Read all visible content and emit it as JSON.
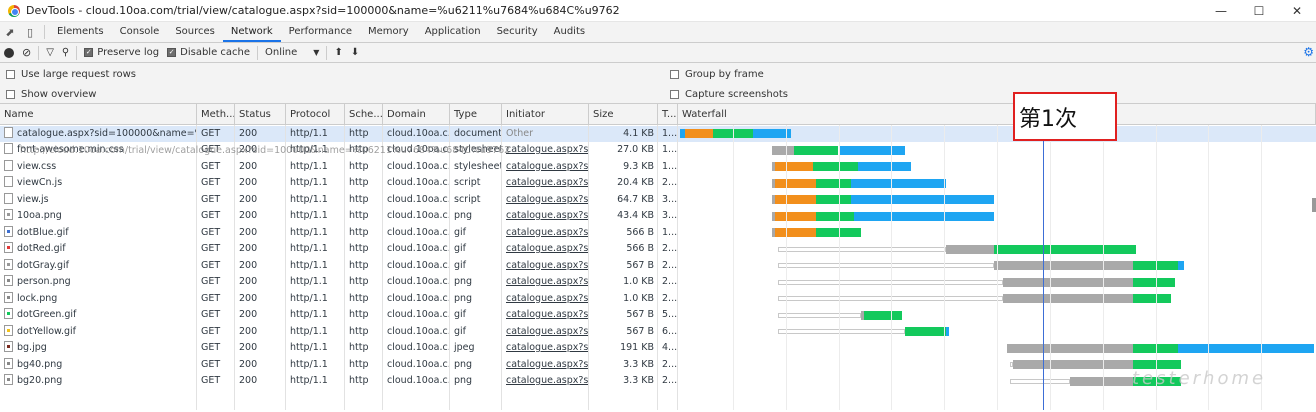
{
  "window": {
    "title": "DevTools - cloud.10oa.com/trial/view/catalogue.aspx?sid=100000&name=%u6211%u7684%u684C%u9762"
  },
  "tabs": [
    "Elements",
    "Console",
    "Sources",
    "Network",
    "Performance",
    "Memory",
    "Application",
    "Security",
    "Audits"
  ],
  "active_tab": "Network",
  "toolbar": {
    "preserve_log": "Preserve log",
    "disable_cache": "Disable cache",
    "throttle": "Online"
  },
  "options": {
    "large_rows": "Use large request rows",
    "show_overview": "Show overview",
    "group_by_frame": "Group by frame",
    "capture_screenshots": "Capture screenshots"
  },
  "columns": [
    "Name",
    "Meth...",
    "Status",
    "Protocol",
    "Sche...",
    "Domain",
    "Type",
    "Initiator",
    "Size",
    "T...",
    "Waterfall"
  ],
  "hover_url": "http://cloud.10oa.com/trial/view/catalogue.aspx?sid=100000&name=%u6211%u7684%u684C%u9762",
  "annotation": "第1次",
  "watermark": "testerhome",
  "colors": {
    "queue": "#a9a9a9",
    "wait": "#f28f1c",
    "ttfb": "#13c95c",
    "download": "#1ea5f2",
    "marker": "#3c6ed6"
  },
  "rows": [
    {
      "name": "catalogue.aspx?sid=100000&name=%u...",
      "method": "GET",
      "status": "200",
      "protocol": "http/1.1",
      "scheme": "http",
      "domain": "cloud.10oa.c...",
      "type": "document",
      "initiator": "Other",
      "size": "4.1 KB",
      "time": "1...",
      "icon": "doc",
      "wf": [
        [
          0.0,
          0.8,
          "#1ea5f2"
        ],
        [
          0.8,
          5.2,
          "#f28f1c"
        ],
        [
          5.2,
          11.5,
          "#13c95c"
        ],
        [
          11.5,
          17.5,
          "#1ea5f2"
        ]
      ]
    },
    {
      "name": "font-awesome.min.css",
      "method": "GET",
      "status": "200",
      "protocol": "http/1.1",
      "scheme": "http",
      "domain": "cloud.10oa.c...",
      "type": "stylesheet",
      "initiator": "catalogue.aspx?si...",
      "size": "27.0 KB",
      "time": "1...",
      "icon": "doc",
      "wf": [
        [
          14.5,
          18.0,
          "#a9a9a9"
        ],
        [
          18.0,
          25.0,
          "#13c95c"
        ],
        [
          25.0,
          35.5,
          "#1ea5f2"
        ]
      ]
    },
    {
      "name": "view.css",
      "method": "GET",
      "status": "200",
      "protocol": "http/1.1",
      "scheme": "http",
      "domain": "cloud.10oa.c...",
      "type": "stylesheet",
      "initiator": "catalogue.aspx?si...",
      "size": "9.3 KB",
      "time": "1...",
      "icon": "doc",
      "wf": [
        [
          14.5,
          15.0,
          "#a9a9a9"
        ],
        [
          15.0,
          21.0,
          "#f28f1c"
        ],
        [
          21.0,
          28.0,
          "#13c95c"
        ],
        [
          28.0,
          36.5,
          "#1ea5f2"
        ]
      ]
    },
    {
      "name": "viewCn.js",
      "method": "GET",
      "status": "200",
      "protocol": "http/1.1",
      "scheme": "http",
      "domain": "cloud.10oa.c...",
      "type": "script",
      "initiator": "catalogue.aspx?si...",
      "size": "20.4 KB",
      "time": "2...",
      "icon": "doc",
      "wf": [
        [
          14.5,
          15.0,
          "#a9a9a9"
        ],
        [
          15.0,
          21.5,
          "#f28f1c"
        ],
        [
          21.5,
          27.0,
          "#13c95c"
        ],
        [
          27.0,
          42.0,
          "#1ea5f2"
        ]
      ]
    },
    {
      "name": "view.js",
      "method": "GET",
      "status": "200",
      "protocol": "http/1.1",
      "scheme": "http",
      "domain": "cloud.10oa.c...",
      "type": "script",
      "initiator": "catalogue.aspx?si...",
      "size": "64.7 KB",
      "time": "3...",
      "icon": "doc",
      "wf": [
        [
          14.5,
          15.0,
          "#a9a9a9"
        ],
        [
          15.0,
          21.5,
          "#f28f1c"
        ],
        [
          21.5,
          27.0,
          "#13c95c"
        ],
        [
          27.0,
          49.5,
          "#1ea5f2"
        ]
      ]
    },
    {
      "name": "10oa.png",
      "method": "GET",
      "status": "200",
      "protocol": "http/1.1",
      "scheme": "http",
      "domain": "cloud.10oa.c...",
      "type": "png",
      "initiator": "catalogue.aspx?si...",
      "size": "43.4 KB",
      "time": "3...",
      "icon": "img",
      "ic": "#999",
      "wf": [
        [
          14.5,
          15.0,
          "#a9a9a9"
        ],
        [
          15.0,
          21.5,
          "#f28f1c"
        ],
        [
          21.5,
          27.5,
          "#13c95c"
        ],
        [
          27.5,
          49.5,
          "#1ea5f2"
        ]
      ]
    },
    {
      "name": "dotBlue.gif",
      "method": "GET",
      "status": "200",
      "protocol": "http/1.1",
      "scheme": "http",
      "domain": "cloud.10oa.c...",
      "type": "gif",
      "initiator": "catalogue.aspx?si...",
      "size": "566 B",
      "time": "1...",
      "icon": "img",
      "ic": "#3d6fd0",
      "wf": [
        [
          14.5,
          15.0,
          "#a9a9a9"
        ],
        [
          15.0,
          21.5,
          "#f28f1c"
        ],
        [
          21.5,
          28.5,
          "#13c95c"
        ]
      ]
    },
    {
      "name": "dotRed.gif",
      "method": "GET",
      "status": "200",
      "protocol": "http/1.1",
      "scheme": "http",
      "domain": "cloud.10oa.c...",
      "type": "gif",
      "initiator": "catalogue.aspx?si...",
      "size": "566 B",
      "time": "2...",
      "icon": "img",
      "ic": "#e23a3a",
      "wf": [
        [
          15.5,
          42.0,
          "#ffffff"
        ],
        [
          42.0,
          49.5,
          "#a9a9a9"
        ],
        [
          49.5,
          72.0,
          "#13c95c"
        ]
      ]
    },
    {
      "name": "dotGray.gif",
      "method": "GET",
      "status": "200",
      "protocol": "http/1.1",
      "scheme": "http",
      "domain": "cloud.10oa.c...",
      "type": "gif",
      "initiator": "catalogue.aspx?si...",
      "size": "567 B",
      "time": "2...",
      "icon": "img",
      "ic": "#999",
      "wf": [
        [
          15.5,
          49.5,
          "#ffffff"
        ],
        [
          49.5,
          71.5,
          "#a9a9a9"
        ],
        [
          71.5,
          78.5,
          "#13c95c"
        ],
        [
          78.5,
          79.5,
          "#1ea5f2"
        ]
      ]
    },
    {
      "name": "person.png",
      "method": "GET",
      "status": "200",
      "protocol": "http/1.1",
      "scheme": "http",
      "domain": "cloud.10oa.c...",
      "type": "png",
      "initiator": "catalogue.aspx?si...",
      "size": "1.0 KB",
      "time": "2...",
      "icon": "img",
      "ic": "#888",
      "wf": [
        [
          15.5,
          51.0,
          "#ffffff"
        ],
        [
          51.0,
          71.5,
          "#a9a9a9"
        ],
        [
          71.5,
          78.0,
          "#13c95c"
        ]
      ]
    },
    {
      "name": "lock.png",
      "method": "GET",
      "status": "200",
      "protocol": "http/1.1",
      "scheme": "http",
      "domain": "cloud.10oa.c...",
      "type": "png",
      "initiator": "catalogue.aspx?si...",
      "size": "1.0 KB",
      "time": "2...",
      "icon": "img",
      "ic": "#888",
      "wf": [
        [
          15.5,
          51.0,
          "#ffffff"
        ],
        [
          51.0,
          71.5,
          "#a9a9a9"
        ],
        [
          71.5,
          77.5,
          "#13c95c"
        ]
      ]
    },
    {
      "name": "dotGreen.gif",
      "method": "GET",
      "status": "200",
      "protocol": "http/1.1",
      "scheme": "http",
      "domain": "cloud.10oa.c...",
      "type": "gif",
      "initiator": "catalogue.aspx?si...",
      "size": "567 B",
      "time": "5...",
      "icon": "img",
      "ic": "#13c95c",
      "wf": [
        [
          15.5,
          28.5,
          "#ffffff"
        ],
        [
          28.5,
          29.0,
          "#a9a9a9"
        ],
        [
          29.0,
          35.0,
          "#13c95c"
        ]
      ]
    },
    {
      "name": "dotYellow.gif",
      "method": "GET",
      "status": "200",
      "protocol": "http/1.1",
      "scheme": "http",
      "domain": "cloud.10oa.c...",
      "type": "gif",
      "initiator": "catalogue.aspx?si...",
      "size": "567 B",
      "time": "6...",
      "icon": "img",
      "ic": "#f2c21c",
      "wf": [
        [
          15.5,
          35.5,
          "#ffffff"
        ],
        [
          35.5,
          42.0,
          "#13c95c"
        ],
        [
          42.0,
          42.5,
          "#1ea5f2"
        ]
      ]
    },
    {
      "name": "bg.jpg",
      "method": "GET",
      "status": "200",
      "protocol": "http/1.1",
      "scheme": "http",
      "domain": "cloud.10oa.c...",
      "type": "jpeg",
      "initiator": "catalogue.aspx?si...",
      "size": "191 KB",
      "time": "4...",
      "icon": "img",
      "ic": "#7a2b20",
      "wf": [
        [
          51.5,
          71.5,
          "#a9a9a9"
        ],
        [
          71.5,
          78.5,
          "#13c95c"
        ],
        [
          78.5,
          100.0,
          "#1ea5f2"
        ]
      ]
    },
    {
      "name": "bg40.png",
      "method": "GET",
      "status": "200",
      "protocol": "http/1.1",
      "scheme": "http",
      "domain": "cloud.10oa.c...",
      "type": "png",
      "initiator": "catalogue.aspx?si...",
      "size": "3.3 KB",
      "time": "2...",
      "icon": "img",
      "ic": "#888",
      "wf": [
        [
          52.0,
          52.5,
          "#ffffff"
        ],
        [
          52.5,
          71.5,
          "#a9a9a9"
        ],
        [
          71.5,
          79.0,
          "#13c95c"
        ]
      ]
    },
    {
      "name": "bg20.png",
      "method": "GET",
      "status": "200",
      "protocol": "http/1.1",
      "scheme": "http",
      "domain": "cloud.10oa.c...",
      "type": "png",
      "initiator": "catalogue.aspx?si...",
      "size": "3.3 KB",
      "time": "2...",
      "icon": "img",
      "ic": "#888",
      "wf": [
        [
          52.0,
          61.5,
          "#ffffff"
        ],
        [
          61.5,
          71.5,
          "#a9a9a9"
        ],
        [
          71.5,
          79.0,
          "#13c95c"
        ]
      ]
    }
  ]
}
